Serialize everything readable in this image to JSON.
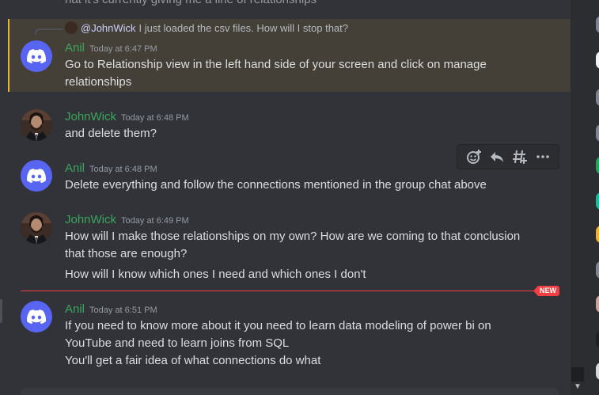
{
  "top_cut_text": "hat it's currently giving me a line of relationships",
  "reply": {
    "mention": "@JohnWick",
    "text": "I just loaded the csv files. How will I stop that?"
  },
  "messages": [
    {
      "username": "Anil",
      "timestamp": "Today at 6:47 PM",
      "lines": [
        "Go to Relationship view in the left hand side of your screen and click on manage",
        "relationships"
      ]
    },
    {
      "username": "JohnWick",
      "timestamp": "Today at 6:48 PM",
      "lines": [
        "and delete them?"
      ]
    },
    {
      "username": "Anil",
      "timestamp": "Today at 6:48 PM",
      "lines": [
        "Delete everything and follow the connections mentioned in the group chat above"
      ]
    },
    {
      "username": "JohnWick",
      "timestamp": "Today at 6:49 PM",
      "lines": [
        "How will I make those relationships on my own? How are we coming to that conclusion",
        "that those are enough?",
        "How will I know which ones I need and which ones I don't"
      ]
    },
    {
      "username": "Anil",
      "timestamp": "Today at 6:51 PM",
      "lines": [
        "If you need to know more about it you need to learn data modeling of power bi on",
        "YouTube and need to learn joins from SQL",
        "You'll get a fair idea of what connections do what"
      ]
    }
  ],
  "new_badge": "NEW",
  "colors": {
    "background": "#313338",
    "username": "#3ba55c",
    "highlight": "#444037",
    "highlight_border": "#f0b232",
    "new_divider": "#f23f43",
    "discord_blurple": "#5865f2"
  },
  "toolbar_icons": [
    "add-reaction-icon",
    "reply-icon",
    "create-thread-icon",
    "more-icon"
  ]
}
